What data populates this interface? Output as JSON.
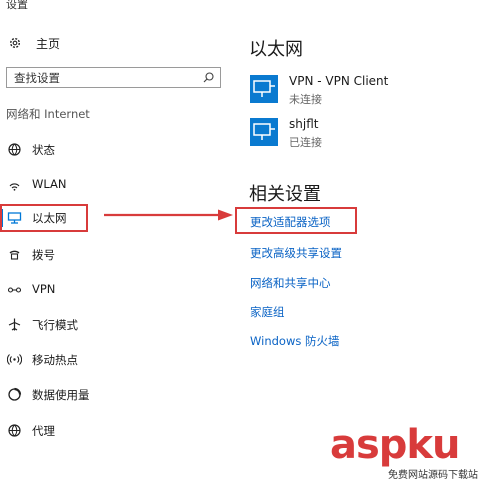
{
  "window": {
    "title": "设置"
  },
  "sidebar": {
    "home_label": "主页",
    "search_placeholder": "查找设置",
    "section_label": "网络和 Internet",
    "items": [
      {
        "label": "状态",
        "icon": "globe-status-icon"
      },
      {
        "label": "WLAN",
        "icon": "wifi-icon"
      },
      {
        "label": "以太网",
        "icon": "ethernet-icon",
        "selected": true
      },
      {
        "label": "拨号",
        "icon": "dialup-icon"
      },
      {
        "label": "VPN",
        "icon": "vpn-icon"
      },
      {
        "label": "飞行模式",
        "icon": "airplane-icon"
      },
      {
        "label": "移动热点",
        "icon": "hotspot-icon"
      },
      {
        "label": "数据使用量",
        "icon": "data-usage-icon"
      },
      {
        "label": "代理",
        "icon": "globe-proxy-icon"
      }
    ]
  },
  "main": {
    "title": "以太网",
    "connections": [
      {
        "name": "VPN - VPN Client",
        "status": "未连接"
      },
      {
        "name": "shjflt",
        "status": "已连接"
      }
    ],
    "related_title": "相关设置",
    "related_links": [
      "更改适配器选项",
      "更改高级共享设置",
      "网络和共享中心",
      "家庭组",
      "Windows 防火墙"
    ]
  },
  "watermark": {
    "logo": "aspku",
    "sub": "免费网站源码下载站"
  },
  "colors": {
    "accent": "#0078d7",
    "link": "#0a63c5",
    "annotation_red": "#d83b3b"
  }
}
